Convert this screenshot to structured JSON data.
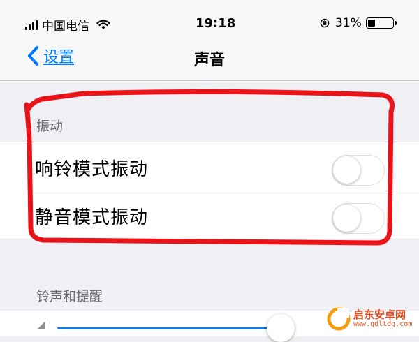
{
  "status_bar": {
    "carrier": "中国电信",
    "time": "19:18",
    "battery_percent": "31%",
    "battery_level": 0.31,
    "signal_icon": "signal-bars-icon",
    "wifi_icon": "wifi-icon",
    "rotation_icon": "rotation-lock-icon"
  },
  "nav": {
    "back_label": "设置",
    "title": "声音",
    "accent_color": "#007aff"
  },
  "sections": {
    "vibration": {
      "header": "振动",
      "rows": [
        {
          "label": "响铃模式振动",
          "on": false
        },
        {
          "label": "静音模式振动",
          "on": false
        }
      ]
    },
    "ringtones": {
      "header": "铃声和提醒",
      "volume_level": 0.95
    }
  },
  "annotation_color": "#e8141a",
  "watermark": {
    "name": "启东安卓网",
    "url": "www.qdltdq.com",
    "color": "#e34b1f"
  }
}
